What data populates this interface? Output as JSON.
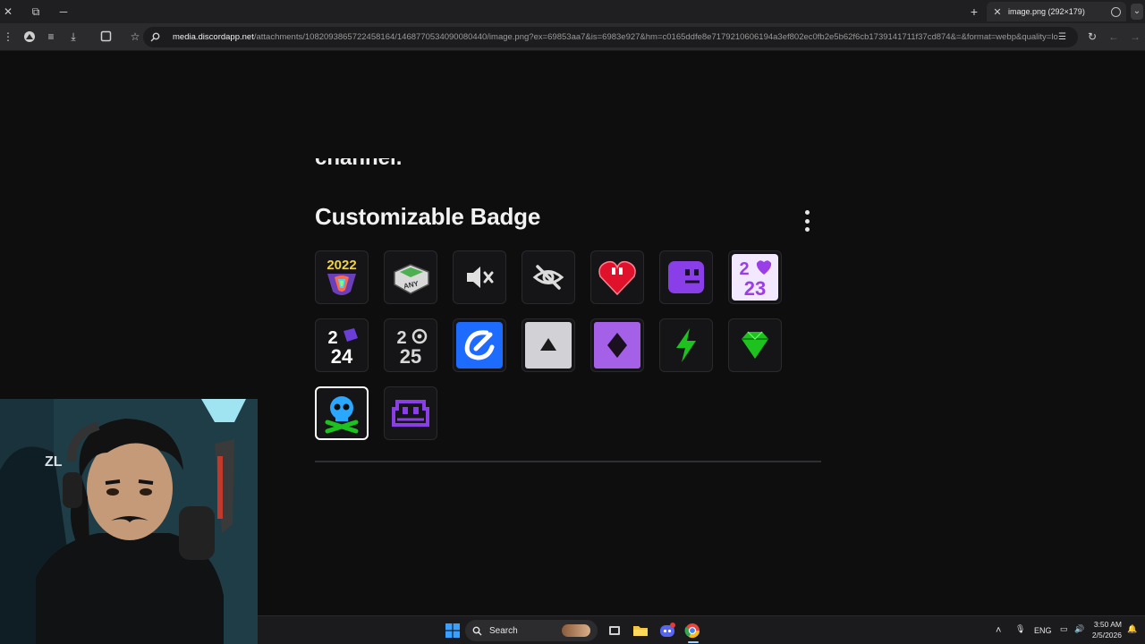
{
  "browser": {
    "tab": {
      "title": "image.png (292×179)"
    },
    "address_bar": {
      "domain": "media.discordapp.net",
      "path": "/attachments/1082093865722458164/1468770534090080440/image.png?ex=69853aa7&is=6983e927&hm=c0165ddfe8e7179210606194a3ef802ec0fb2e5b62f6cb1739141711f37cd874&=&format=webp&quality=lo..."
    }
  },
  "page": {
    "cut_off_text": "channel.",
    "section_title": "Customizable Badge",
    "badge_2022_text": "2022",
    "badge_any_text": "ANY",
    "badge_2023_top": "2",
    "badge_2023_right": "3",
    "badge_2023_bottom": "23",
    "badge_2024_top": "2",
    "badge_2024_bottom": "24",
    "badge_2025_top": "2",
    "badge_2025_bottom": "25",
    "badges": [
      {
        "name": "2022",
        "icon": "year-2022-badge-icon"
      },
      {
        "name": "any-key",
        "icon": "keyboard-key-badge-icon"
      },
      {
        "name": "muted",
        "icon": "speaker-muted-badge-icon"
      },
      {
        "name": "hidden",
        "icon": "eye-slash-badge-icon"
      },
      {
        "name": "glitch-heart",
        "icon": "heart-badge-icon"
      },
      {
        "name": "glitch-face",
        "icon": "purple-face-badge-icon"
      },
      {
        "name": "2023",
        "icon": "year-2023-badge-icon"
      },
      {
        "name": "2024",
        "icon": "year-2024-badge-icon"
      },
      {
        "name": "2025",
        "icon": "year-2025-badge-icon"
      },
      {
        "name": "blue-logo",
        "icon": "blue-swoosh-badge-icon"
      },
      {
        "name": "gray-triangle",
        "icon": "triangle-badge-icon"
      },
      {
        "name": "purple-diamond",
        "icon": "diamond-badge-icon"
      },
      {
        "name": "green-bolt",
        "icon": "lightning-bolt-badge-icon"
      },
      {
        "name": "green-gem",
        "icon": "gem-badge-icon"
      },
      {
        "name": "skull",
        "icon": "skull-badge-icon",
        "selected": true
      },
      {
        "name": "purple-glyph",
        "icon": "purple-glyph-badge-icon"
      }
    ]
  },
  "webcam": {
    "tag": "ZL"
  },
  "taskbar": {
    "search_label": "Search",
    "language": "ENG",
    "time": "3:50 AM",
    "date": "2/5/2026",
    "discord_badge": "99"
  },
  "colors": {
    "background": "#0e0e0f",
    "chrome_toolbar": "#2b2b2e",
    "purple": "#8a2be2",
    "green": "#1ec21e",
    "blue": "#1e6cff"
  }
}
